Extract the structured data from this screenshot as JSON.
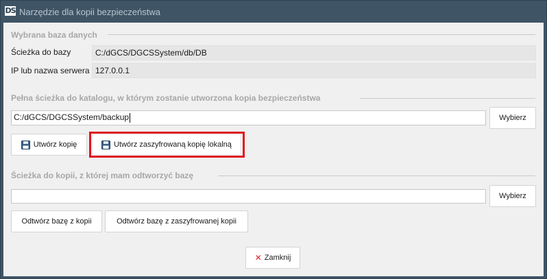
{
  "window": {
    "logo": "DS",
    "title": "Narzędzie dla kopii bezpieczeństwa"
  },
  "database": {
    "group_title": "Wybrana baza danych",
    "path_label": "Ścieżka do bazy",
    "path_value": "C:/dGCS/DGCSSystem/db/DB",
    "server_label": "IP lub nazwa serwera",
    "server_value": "127.0.0.1"
  },
  "backup": {
    "group_title": "Pełna ścieżka do katalogu, w którym zostanie utworzona kopia bezpieczeństwa",
    "path_value": "C:/dGCS/DGCSSystem/backup",
    "browse_label": "Wybierz",
    "create_label": "Utwórz kopię",
    "create_encrypted_label": "Utwórz zaszyfrowaną kopię lokalną"
  },
  "restore": {
    "group_title": "Ścieżka do kopii, z której mam odtworzyć bazę",
    "path_value": "",
    "browse_label": "Wybierz",
    "restore_label": "Odtwórz bazę z kopii",
    "restore_encrypted_label": "Odtwórz bazę z zaszyfrowanej kopii"
  },
  "footer": {
    "close_label": "Zamknij"
  },
  "colors": {
    "titlebar": "#3f5566",
    "highlight": "#e0151d",
    "close_icon": "#d9242a"
  },
  "icons": {
    "save": "floppy-disk-icon",
    "close": "x-icon"
  }
}
